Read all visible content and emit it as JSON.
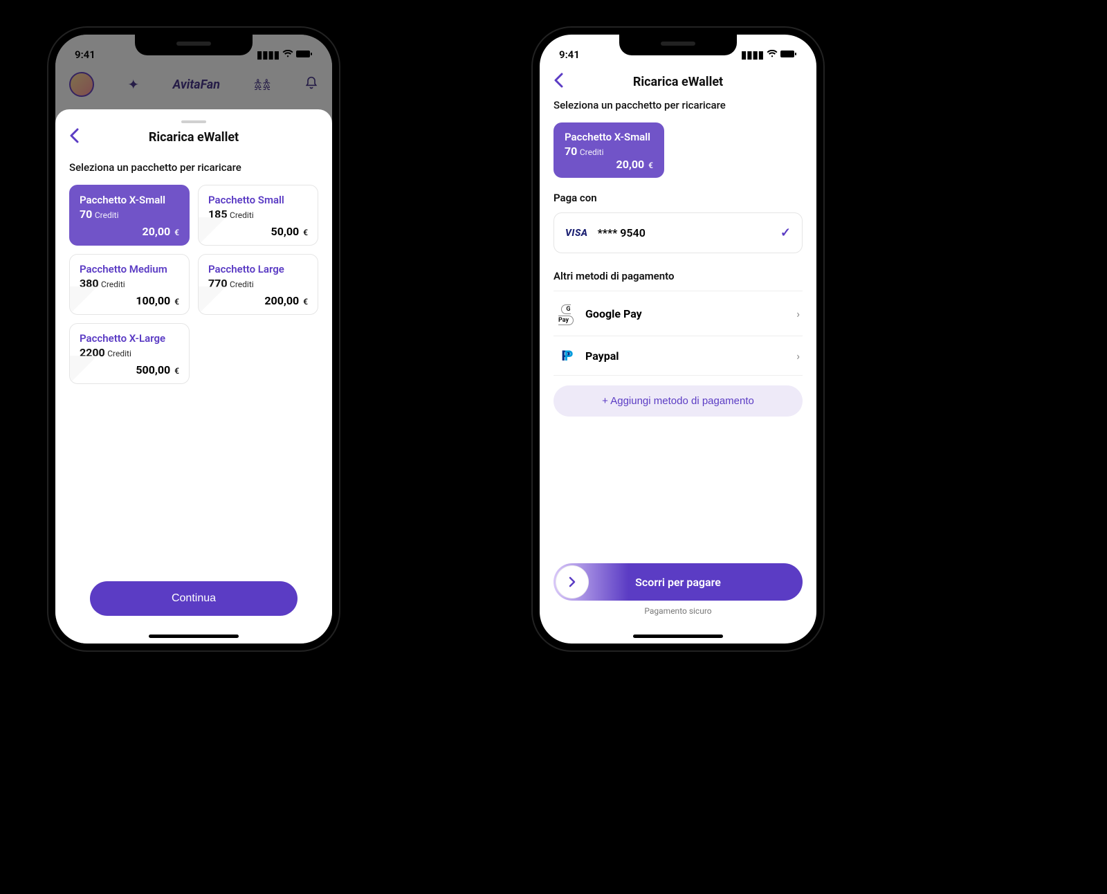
{
  "status": {
    "time": "9:41"
  },
  "logo": "AvitaFan",
  "sheet": {
    "title": "Ricarica eWallet",
    "subtitle": "Seleziona un pacchetto per ricaricare",
    "credits_label": "Crediti",
    "currency": "€",
    "packs": [
      {
        "name": "Pacchetto X-Small",
        "credits": "70",
        "price": "20,00",
        "selected": true
      },
      {
        "name": "Pacchetto Small",
        "credits": "185",
        "price": "50,00",
        "selected": false
      },
      {
        "name": "Pacchetto Medium",
        "credits": "380",
        "price": "100,00",
        "selected": false
      },
      {
        "name": "Pacchetto Large",
        "credits": "770",
        "price": "200,00",
        "selected": false
      },
      {
        "name": "Pacchetto X-Large",
        "credits": "2200",
        "price": "500,00",
        "selected": false
      }
    ],
    "cta": "Continua"
  },
  "pay": {
    "title": "Ricarica eWallet",
    "subtitle": "Seleziona un pacchetto per ricaricare",
    "selected_pack": {
      "name": "Pacchetto X-Small",
      "credits": "70",
      "price": "20,00"
    },
    "section_pay_with": "Paga con",
    "card": {
      "brand": "VISA",
      "masked": "**** 9540"
    },
    "section_other": "Altri metodi di pagamento",
    "methods": [
      {
        "name": "Google Pay",
        "icon": "gpay"
      },
      {
        "name": "Paypal",
        "icon": "paypal"
      }
    ],
    "add_method": "+  Aggiungi metodo di pagamento",
    "swipe": "Scorri per pagare",
    "secure": "Pagamento sicuro"
  }
}
